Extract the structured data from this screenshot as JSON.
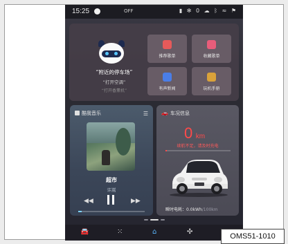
{
  "status_bar": {
    "time": "15:25",
    "off_label": "OFF",
    "icons": [
      "signal-bars-icon",
      "fan-icon",
      "zero-icon",
      "weather-icon",
      "bluetooth-icon",
      "wifi-icon",
      "flag-icon"
    ]
  },
  "assistant": {
    "hint_main": "“附近的停车场”",
    "hint_second": "“打开空调”",
    "hint_third": "“打开香薰机”"
  },
  "quick_tiles": [
    {
      "label": "推荐歌单",
      "icon": "music-list-icon",
      "color": "#e65a5a"
    },
    {
      "label": "收藏歌单",
      "icon": "heart-icon",
      "color": "#e85d7a"
    },
    {
      "label": "有声新闻",
      "icon": "news-icon",
      "color": "#4a7ee8"
    },
    {
      "label": "玩机手册",
      "icon": "manual-icon",
      "color": "#d9a23a"
    }
  ],
  "music": {
    "card_title": "酷我音乐",
    "song": "超市",
    "artist": "许嵩",
    "progress": 0.05
  },
  "car": {
    "card_title": "车况信息",
    "range_value": "0",
    "range_unit": "km",
    "warning": "续航不足，请及时充电",
    "energy_label": "瞬时电耗：",
    "energy_value": "0.0kWh",
    "energy_unit": "/100km",
    "battery_level": 0.02
  },
  "nav": {
    "items": [
      "car-icon",
      "apps-grid-icon",
      "home-icon",
      "fan-icon",
      "settings-icon"
    ],
    "active": "home-icon"
  },
  "figure_tag": "OMS51-1010",
  "colors": {
    "accent": "#5cb8ff",
    "warning": "#ff4a4a"
  }
}
